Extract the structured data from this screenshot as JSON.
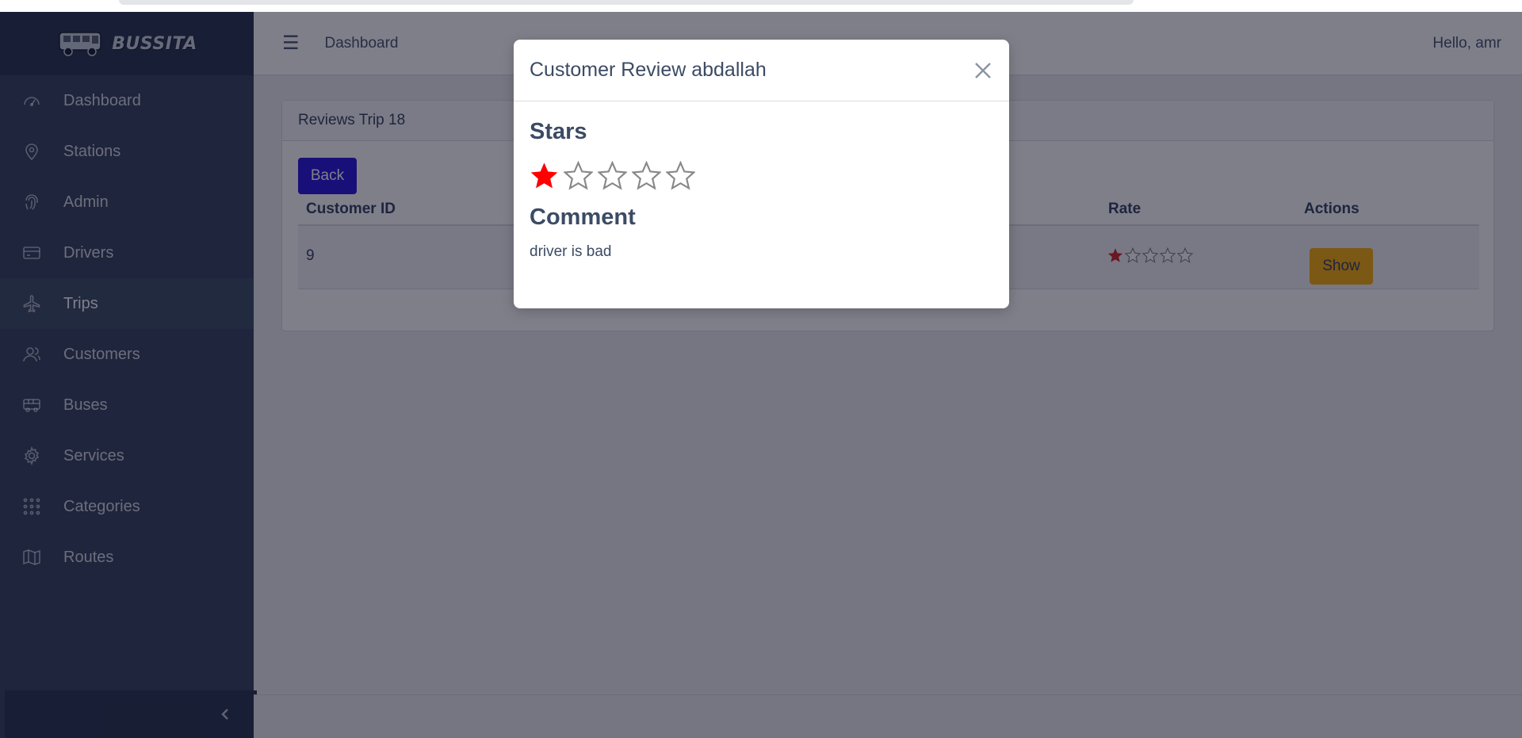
{
  "brand": {
    "name": "BUSSITA",
    "logo": "bus-logo-icon"
  },
  "sidebar": {
    "items": [
      {
        "label": "Dashboard",
        "icon": "speedometer-icon",
        "active": false
      },
      {
        "label": "Stations",
        "icon": "location-pin-icon",
        "active": false
      },
      {
        "label": "Admin",
        "icon": "fingerprint-icon",
        "active": false
      },
      {
        "label": "Drivers",
        "icon": "credit-card-icon",
        "active": false
      },
      {
        "label": "Trips",
        "icon": "airplane-icon",
        "active": true
      },
      {
        "label": "Customers",
        "icon": "people-icon",
        "active": false
      },
      {
        "label": "Buses",
        "icon": "bus-icon",
        "active": false
      },
      {
        "label": "Services",
        "icon": "gear-icon",
        "active": false
      },
      {
        "label": "Categories",
        "icon": "grid-dots-icon",
        "active": false
      },
      {
        "label": "Routes",
        "icon": "map-icon",
        "active": false
      }
    ],
    "toggler_icon": "chevron-left-icon"
  },
  "header": {
    "menu_icon": "☰",
    "nav_link": "Dashboard",
    "greeting": "Hello, amr"
  },
  "card": {
    "title": "Reviews Trip 18",
    "back_label": "Back",
    "columns": {
      "customer_id": "Customer ID",
      "rate": "Rate",
      "actions": "Actions"
    },
    "rows": [
      {
        "customer_id": "9",
        "rate": 1,
        "max_rate": 5,
        "action_label": "Show"
      }
    ]
  },
  "modal": {
    "title": "Customer Review abdallah",
    "stars_heading": "Stars",
    "stars": 1,
    "max_stars": 5,
    "comment_heading": "Comment",
    "comment": "driver is bad"
  },
  "colors": {
    "sidebar": "#3c4b64",
    "primary": "#321fdb",
    "warning": "#f9b115",
    "star_filled": "#ff0000",
    "star_outline": "#888888"
  }
}
